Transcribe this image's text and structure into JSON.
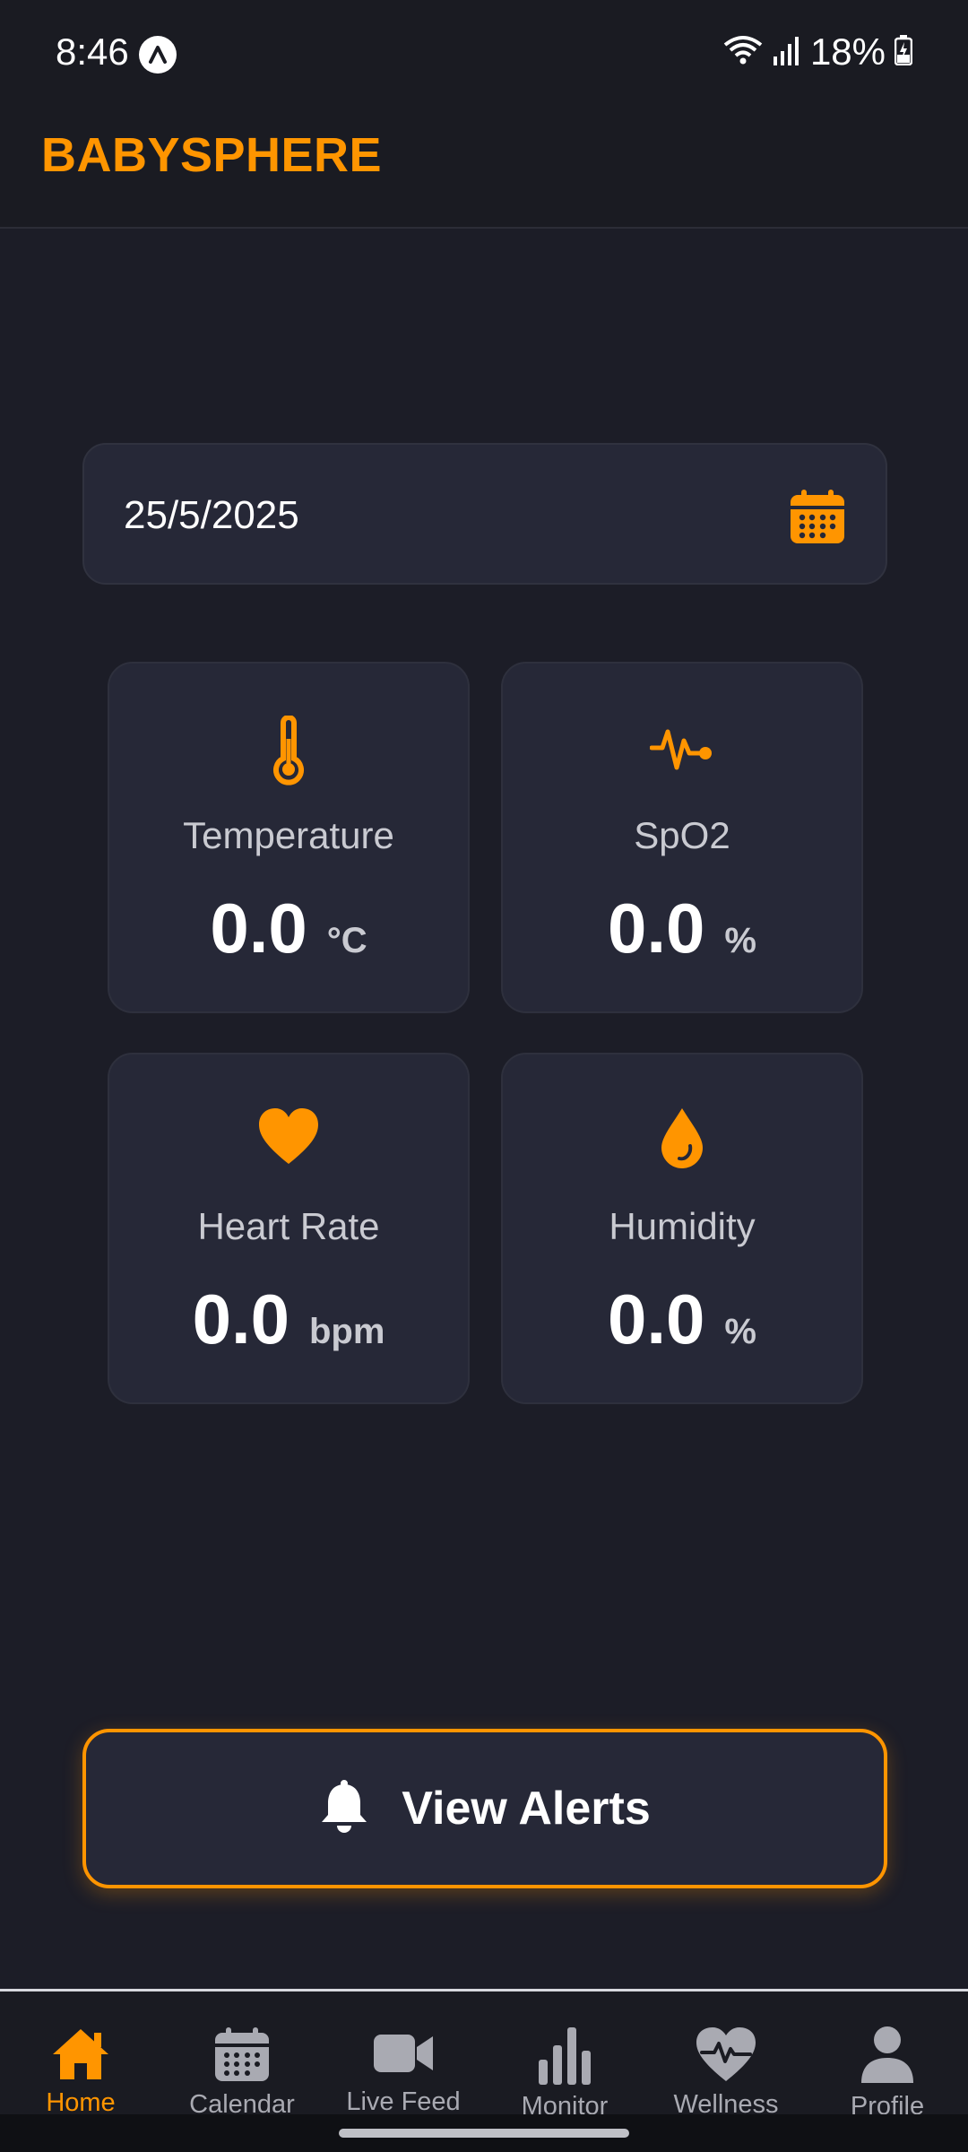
{
  "status_bar": {
    "time": "8:46",
    "battery": "18%"
  },
  "header": {
    "title": "BABYSPHERE"
  },
  "date_picker": {
    "value": "25/5/2025"
  },
  "metrics": [
    {
      "label": "Temperature",
      "value": "0.0",
      "unit": "°C",
      "icon": "thermometer-icon"
    },
    {
      "label": "SpO2",
      "value": "0.0",
      "unit": "%",
      "icon": "pulse-icon"
    },
    {
      "label": "Heart Rate",
      "value": "0.0",
      "unit": "bpm",
      "icon": "heart-icon"
    },
    {
      "label": "Humidity",
      "value": "0.0",
      "unit": "%",
      "icon": "water-drop-icon"
    }
  ],
  "alerts_button": {
    "label": "View Alerts"
  },
  "nav": [
    {
      "label": "Home",
      "active": true
    },
    {
      "label": "Calendar"
    },
    {
      "label": "Live Feed"
    },
    {
      "label": "Monitor"
    },
    {
      "label": "Wellness"
    },
    {
      "label": "Profile"
    }
  ],
  "colors": {
    "accent": "#ff9500",
    "background": "#1c1d27",
    "card": "#262837"
  }
}
